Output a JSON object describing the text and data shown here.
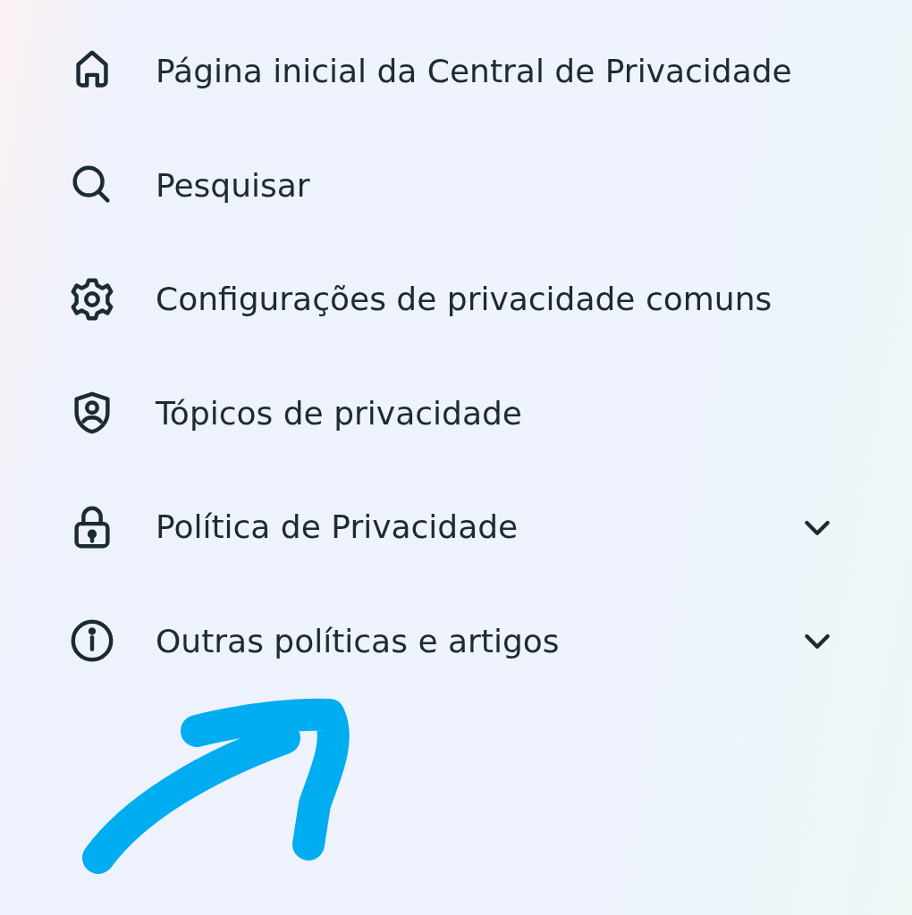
{
  "menu": {
    "items": [
      {
        "label": "Página inicial da Central de Privacidade"
      },
      {
        "label": "Pesquisar"
      },
      {
        "label": "Configurações de privacidade comuns"
      },
      {
        "label": "Tópicos de privacidade"
      },
      {
        "label": "Política de Privacidade",
        "expanded": false
      },
      {
        "label": "Outras políticas e artigos",
        "expanded": false
      }
    ]
  },
  "annotation": {
    "kind": "arrow"
  }
}
